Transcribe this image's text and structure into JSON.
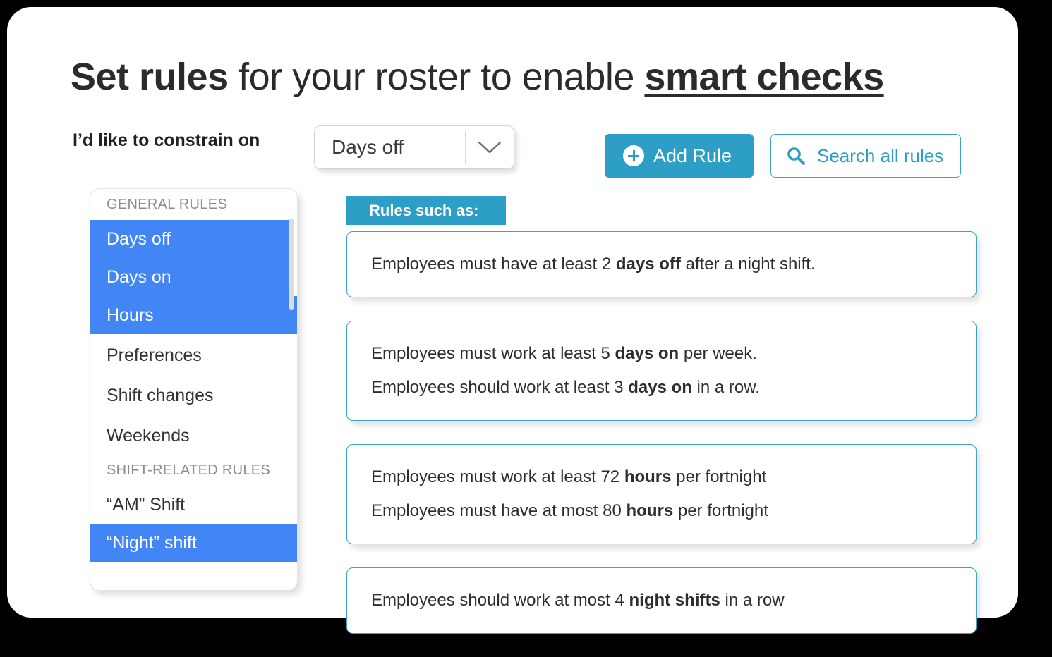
{
  "title": {
    "part1": "Set rules",
    "part2": " for your roster to enable ",
    "part3": "smart checks"
  },
  "controls": {
    "constrain_label": "I’d like to constrain on",
    "dropdown_value": "Days off",
    "dropdown_icon": "chevron-down-icon",
    "add_rule_label": "Add Rule",
    "add_rule_icon": "circle-plus-icon",
    "search_label": "Search all rules",
    "search_icon": "search-icon"
  },
  "category_panel": {
    "groups": [
      {
        "header": "GENERAL RULES",
        "items": [
          {
            "label": "Days off",
            "selected": true
          },
          {
            "label": "Days on",
            "selected": true
          },
          {
            "label": "Hours",
            "selected": true
          },
          {
            "label": "Preferences",
            "selected": false
          },
          {
            "label": "Shift changes",
            "selected": false
          },
          {
            "label": "Weekends",
            "selected": false
          }
        ]
      },
      {
        "header": "SHIFT-RELATED RULES",
        "items": [
          {
            "label": "“AM” Shift",
            "selected": false
          },
          {
            "label": "“Night” shift",
            "selected": true
          }
        ]
      }
    ]
  },
  "rules_panel": {
    "banner_label": "Rules such as:",
    "cards": [
      {
        "lines": [
          {
            "pre": "Employees must have at least 2 ",
            "bold": "days off",
            "post": " after a night shift."
          }
        ]
      },
      {
        "lines": [
          {
            "pre": "Employees must work at least 5 ",
            "bold": "days on",
            "post": " per week."
          },
          {
            "pre": "Employees should work at least 3 ",
            "bold": "days on",
            "post": " in a row."
          }
        ]
      },
      {
        "lines": [
          {
            "pre": "Employees must work at least 72 ",
            "bold": "hours",
            "post": " per fortnight"
          },
          {
            "pre": "Employees must have at most 80 ",
            "bold": "hours",
            "post": " per fortnight"
          }
        ]
      },
      {
        "lines": [
          {
            "pre": "Employees should work at most 4 ",
            "bold": "night shifts",
            "post": " in a row"
          }
        ]
      }
    ]
  },
  "colors": {
    "accent_teal": "#2d9ec6",
    "selection_blue": "#4285f4",
    "card_border": "#3aa3cb",
    "page_background": "#000000",
    "surface": "#ffffff"
  }
}
